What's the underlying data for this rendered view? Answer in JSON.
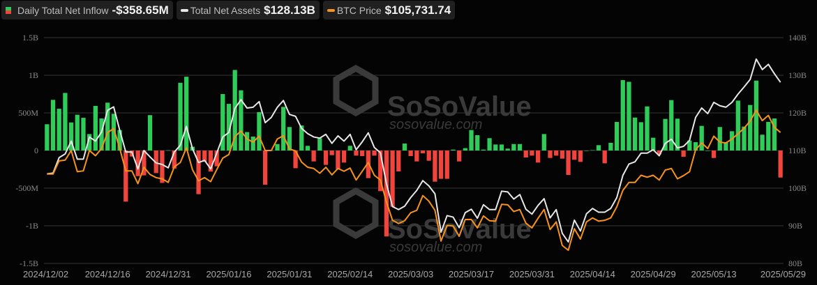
{
  "legend": [
    {
      "label": "Daily Total Net Inflow",
      "value": "-$358.65M",
      "icon": "split-green-red-square"
    },
    {
      "label": "Total Net Assets",
      "value": "$128.13B",
      "icon": "white-line"
    },
    {
      "label": "BTC Price",
      "value": "$105,731.74",
      "icon": "orange-line"
    }
  ],
  "watermark": {
    "brand": "SoSoValue",
    "url": "sosovalue.com"
  },
  "colors": {
    "inflow_pos": "#2fcc5a",
    "inflow_neg": "#f0443c",
    "assets": "#e8e8e8",
    "price": "#f7931a",
    "grid": "#333333"
  },
  "chart_data": {
    "type": "bar+line",
    "title": "",
    "left_axis": {
      "label": "Daily Total Net Inflow",
      "ticks": [
        "1.5B",
        "1B",
        "500M",
        "0",
        "-500M",
        "-1B",
        "-1.5B"
      ],
      "range_millions": [
        -1500,
        1500
      ]
    },
    "right_axis": {
      "label": "Total Net Assets",
      "ticks": [
        "140B",
        "130B",
        "120B",
        "110B",
        "100B",
        "90B",
        "80B"
      ],
      "range_billions": [
        80,
        140
      ]
    },
    "price_axis_hidden_range_usd": [
      72900,
      129500
    ],
    "x_tick_labels": [
      {
        "index": 0,
        "label": "2024/12/02"
      },
      {
        "index": 10,
        "label": "2024/12/16"
      },
      {
        "index": 20,
        "label": "2024/12/31"
      },
      {
        "index": 30,
        "label": "2025/01/16"
      },
      {
        "index": 40,
        "label": "2025/01/31"
      },
      {
        "index": 50,
        "label": "2025/02/14"
      },
      {
        "index": 60,
        "label": "2025/03/03"
      },
      {
        "index": 70,
        "label": "2025/03/17"
      },
      {
        "index": 80,
        "label": "2025/03/31"
      },
      {
        "index": 90,
        "label": "2025/04/14"
      },
      {
        "index": 100,
        "label": "2025/04/29"
      },
      {
        "index": 110,
        "label": "2025/05/13"
      },
      {
        "index": 121,
        "label": "2025/05/29"
      }
    ],
    "series": [
      {
        "name": "Daily Total Net Inflow",
        "unit": "USD millions",
        "type": "bar",
        "values": [
          349,
          673,
          555,
          765,
          373,
          475,
          435,
          219,
          593,
          426,
          636,
          488,
          272,
          -679,
          -80,
          -340,
          -330,
          470,
          -300,
          -430,
          3,
          -240,
          900,
          980,
          50,
          -580,
          -150,
          -280,
          -210,
          750,
          620,
          1070,
          800,
          245,
          185,
          510,
          -455,
          2,
          86,
          580,
          312,
          -235,
          333,
          62,
          -145,
          164,
          -191,
          -62,
          -247,
          -160,
          62,
          -68,
          -74,
          -367,
          -68,
          -540,
          -1142,
          -747,
          -278,
          93,
          -74,
          -145,
          -37,
          -136,
          -414,
          -376,
          -376,
          12,
          -145,
          31,
          272,
          204,
          12,
          164,
          80,
          80,
          25,
          86,
          86,
          -93,
          -68,
          -160,
          219,
          -99,
          -68,
          -108,
          -324,
          -123,
          -151,
          0,
          5,
          71,
          -170,
          102,
          380,
          935,
          913,
          438,
          376,
          586,
          170,
          -52,
          420,
          670,
          423,
          -83,
          133,
          111,
          327,
          0,
          -99,
          312,
          108,
          256,
          663,
          318,
          605,
          929,
          210,
          380,
          426,
          -358.65
        ]
      },
      {
        "name": "Total Net Assets",
        "unit": "USD billions",
        "type": "line",
        "values": [
          103.8,
          104.0,
          108.1,
          109.1,
          112.5,
          107.7,
          107.7,
          113.6,
          112.5,
          114.9,
          120.7,
          121.6,
          115.4,
          109.6,
          109.6,
          105.1,
          110.0,
          108.3,
          106.7,
          106.3,
          105.4,
          109.6,
          111.4,
          116.4,
          110.5,
          106.8,
          107.4,
          105.1,
          109.3,
          113.6,
          114.8,
          121.2,
          123.5,
          121.3,
          121.5,
          123.0,
          117.4,
          118.8,
          121.5,
          123.3,
          119.6,
          119.1,
          115.9,
          114.5,
          113.6,
          113.3,
          114.3,
          111.9,
          113.9,
          112.5,
          114.3,
          110.2,
          112.3,
          114.7,
          110.8,
          109.4,
          101.2,
          95.1,
          94.3,
          95.2,
          97.5,
          99.4,
          102.0,
          100.6,
          98.5,
          88.3,
          92.7,
          92.3,
          89.5,
          93.5,
          94.4,
          92.0,
          95.6,
          94.3,
          94.3,
          99.2,
          99.0,
          97.1,
          98.3,
          94.4,
          93.1,
          95.4,
          97.2,
          92.1,
          94.3,
          88.0,
          85.7,
          91.5,
          88.6,
          93.2,
          94.6,
          93.6,
          93.6,
          94.6,
          97.5,
          103.4,
          106.4,
          107.0,
          109.3,
          109.3,
          110.2,
          108.6,
          111.9,
          113.0,
          110.7,
          111.1,
          112.7,
          118.8,
          121.3,
          119.8,
          122.8,
          121.9,
          121.5,
          122.8,
          125.0,
          126.9,
          128.9,
          134.3,
          131.5,
          132.9,
          130.4,
          128.13
        ]
      },
      {
        "name": "BTC Price",
        "unit": "USD thousands",
        "type": "line",
        "values": [
          95.3,
          95.3,
          98.6,
          98.8,
          101.2,
          95.9,
          96.1,
          101.2,
          99.9,
          101.7,
          105.7,
          106.7,
          101.7,
          96.1,
          96.1,
          92.9,
          97.0,
          95.2,
          94.4,
          94.1,
          93.2,
          97.1,
          98.2,
          101.9,
          96.4,
          93.6,
          94.4,
          93.4,
          96.4,
          99.3,
          100.2,
          104.7,
          106.1,
          104.1,
          103.3,
          104.8,
          101.2,
          101.2,
          104.1,
          104.9,
          101.6,
          101.1,
          98.3,
          97.0,
          96.7,
          95.5,
          97.0,
          95.1,
          96.7,
          96.0,
          96.8,
          93.8,
          96.0,
          98.2,
          95.0,
          93.8,
          88.3,
          83.7,
          82.9,
          83.6,
          85.6,
          86.2,
          89.9,
          88.5,
          86.2,
          78.5,
          82.4,
          82.3,
          79.7,
          83.9,
          83.9,
          81.8,
          84.8,
          83.6,
          83.5,
          87.7,
          87.6,
          85.9,
          86.4,
          83.0,
          81.8,
          84.2,
          86.4,
          81.4,
          83.3,
          77.4,
          76.2,
          81.6,
          79.0,
          83.3,
          84.3,
          83.5,
          83.7,
          84.3,
          87.1,
          91.2,
          93.2,
          93.2,
          95.0,
          94.5,
          95.0,
          93.8,
          96.3,
          96.7,
          94.1,
          94.9,
          95.9,
          101.4,
          103.1,
          101.7,
          104.8,
          103.3,
          103.1,
          104.1,
          105.4,
          106.8,
          108.6,
          111.3,
          108.7,
          110.0,
          107.0,
          105.73
        ]
      }
    ]
  }
}
